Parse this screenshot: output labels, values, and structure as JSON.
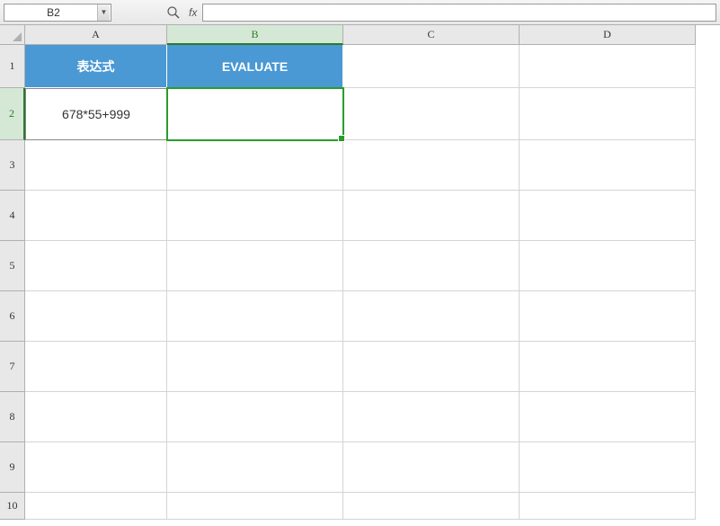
{
  "namebox": {
    "value": "B2"
  },
  "formula_bar": {
    "value": ""
  },
  "columns": [
    "A",
    "B",
    "C",
    "D"
  ],
  "rows": [
    "1",
    "2",
    "3",
    "4",
    "5",
    "6",
    "7",
    "8",
    "9",
    "10"
  ],
  "active_cell": "B2",
  "cells": {
    "A1": {
      "value": "表达式",
      "style": "header"
    },
    "B1": {
      "value": "EVALUATE",
      "style": "header"
    },
    "A2": {
      "value": "678*55+999",
      "style": "data"
    },
    "B2": {
      "value": "",
      "style": "data"
    }
  }
}
